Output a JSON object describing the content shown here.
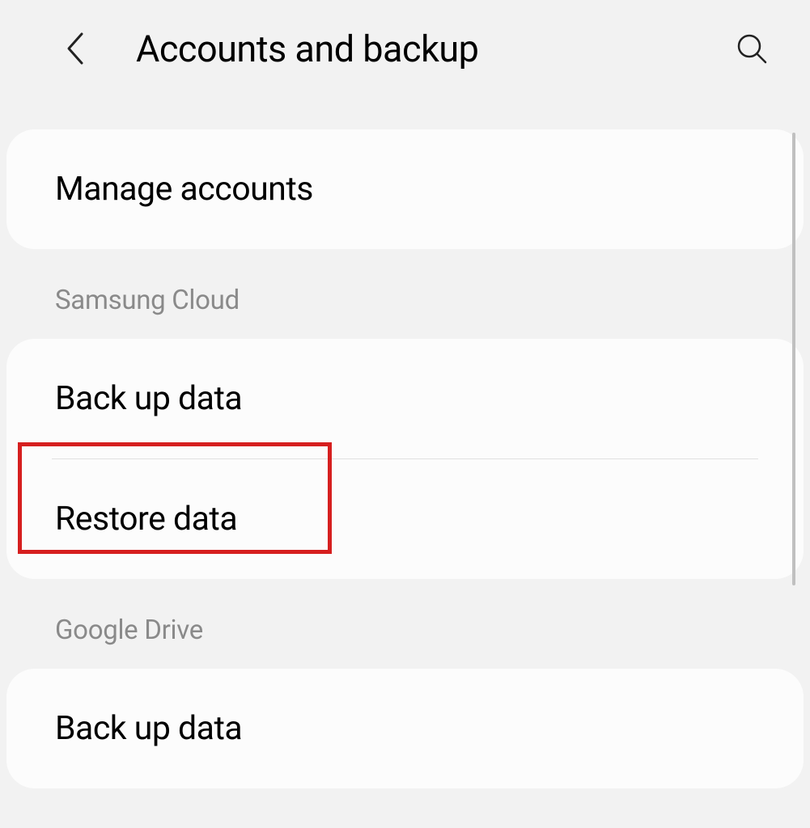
{
  "header": {
    "title": "Accounts and backup"
  },
  "sections": {
    "standalone": {
      "item0": "Manage accounts"
    },
    "samsung_cloud": {
      "label": "Samsung Cloud",
      "item0": "Back up data",
      "item1": "Restore data"
    },
    "google_drive": {
      "label": "Google Drive",
      "item0": "Back up data"
    }
  },
  "highlight": {
    "target": "restore-data"
  }
}
